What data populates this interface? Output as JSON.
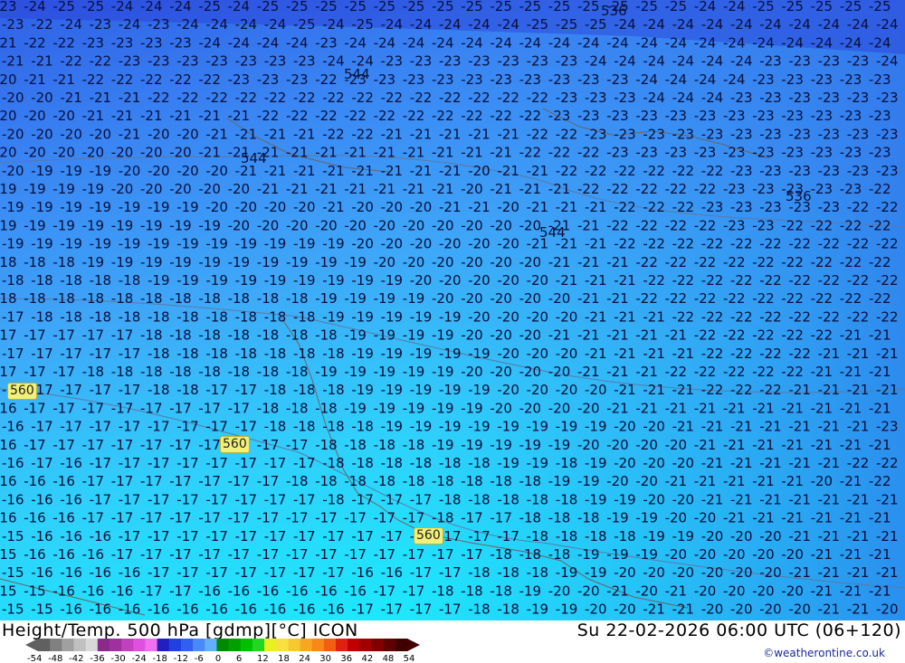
{
  "map": {
    "title": "Height/Temp. 500 hPa [gdmp][°C] ICON",
    "valid_time": "Su 22-02-2026 06:00 UTC (06+120)",
    "credit": "©weatherontine.co.uk",
    "height_labels": [
      "544",
      "544",
      "536",
      "544",
      "536",
      "560",
      "560",
      "560"
    ],
    "temperature_grid": [
      [
        "23",
        "24",
        "25",
        "25",
        "24",
        "24",
        "24",
        "25",
        "24",
        "25",
        "25",
        "25",
        "25",
        "25",
        "25",
        "25",
        "25",
        "25",
        "25",
        "25",
        "25",
        "25",
        "25",
        "25",
        "24",
        "24",
        "25",
        "25",
        "25",
        "25",
        "25",
        "24"
      ],
      [
        "23",
        "22",
        "24",
        "23",
        "24",
        "23",
        "24",
        "24",
        "24",
        "24",
        "25",
        "24",
        "25",
        "24",
        "24",
        "24",
        "24",
        "24",
        "25",
        "25",
        "25",
        "24",
        "24",
        "24",
        "24",
        "24",
        "24",
        "24",
        "24",
        "24",
        "24",
        "25"
      ],
      [
        "21",
        "22",
        "22",
        "23",
        "23",
        "23",
        "23",
        "24",
        "24",
        "24",
        "24",
        "23",
        "24",
        "24",
        "24",
        "24",
        "24",
        "24",
        "24",
        "24",
        "24",
        "24",
        "24",
        "24",
        "24",
        "24",
        "24",
        "24",
        "24",
        "24",
        "24",
        "24"
      ],
      [
        "21",
        "21",
        "22",
        "22",
        "23",
        "23",
        "23",
        "23",
        "23",
        "23",
        "23",
        "24",
        "24",
        "23",
        "23",
        "23",
        "23",
        "23",
        "23",
        "23",
        "24",
        "24",
        "24",
        "24",
        "24",
        "24",
        "23",
        "23",
        "23",
        "23",
        "24",
        "24"
      ],
      [
        "20",
        "21",
        "21",
        "22",
        "22",
        "22",
        "22",
        "22",
        "23",
        "23",
        "23",
        "22",
        "23",
        "23",
        "23",
        "23",
        "23",
        "23",
        "23",
        "23",
        "23",
        "23",
        "24",
        "24",
        "24",
        "24",
        "23",
        "23",
        "23",
        "23",
        "23",
        "23"
      ],
      [
        "20",
        "20",
        "21",
        "21",
        "21",
        "22",
        "22",
        "22",
        "22",
        "22",
        "22",
        "22",
        "22",
        "22",
        "22",
        "22",
        "22",
        "22",
        "22",
        "23",
        "23",
        "23",
        "24",
        "24",
        "24",
        "23",
        "23",
        "23",
        "23",
        "23",
        "23",
        "24"
      ],
      [
        "20",
        "20",
        "20",
        "21",
        "21",
        "21",
        "21",
        "21",
        "21",
        "22",
        "22",
        "22",
        "22",
        "22",
        "22",
        "22",
        "22",
        "22",
        "22",
        "23",
        "23",
        "23",
        "23",
        "23",
        "23",
        "23",
        "23",
        "23",
        "23",
        "23",
        "23",
        "23"
      ],
      [
        "20",
        "20",
        "20",
        "20",
        "21",
        "20",
        "20",
        "21",
        "21",
        "21",
        "21",
        "22",
        "22",
        "21",
        "21",
        "21",
        "21",
        "21",
        "22",
        "22",
        "23",
        "23",
        "23",
        "23",
        "23",
        "23",
        "23",
        "23",
        "23",
        "23",
        "23",
        "23"
      ],
      [
        "20",
        "20",
        "20",
        "20",
        "20",
        "20",
        "20",
        "21",
        "21",
        "21",
        "21",
        "21",
        "21",
        "21",
        "21",
        "21",
        "21",
        "21",
        "22",
        "22",
        "22",
        "23",
        "23",
        "23",
        "23",
        "23",
        "23",
        "23",
        "23",
        "23",
        "23",
        "23"
      ],
      [
        "20",
        "19",
        "19",
        "19",
        "20",
        "20",
        "20",
        "20",
        "21",
        "21",
        "21",
        "21",
        "21",
        "21",
        "21",
        "21",
        "20",
        "21",
        "21",
        "22",
        "22",
        "22",
        "22",
        "22",
        "22",
        "23",
        "23",
        "23",
        "23",
        "23",
        "23",
        "23"
      ],
      [
        "19",
        "19",
        "19",
        "19",
        "20",
        "20",
        "20",
        "20",
        "20",
        "21",
        "21",
        "21",
        "21",
        "21",
        "21",
        "21",
        "20",
        "21",
        "21",
        "21",
        "22",
        "22",
        "22",
        "22",
        "22",
        "23",
        "23",
        "23",
        "23",
        "23",
        "22",
        "22"
      ],
      [
        "19",
        "19",
        "19",
        "19",
        "19",
        "19",
        "19",
        "20",
        "20",
        "20",
        "20",
        "21",
        "20",
        "20",
        "20",
        "21",
        "21",
        "20",
        "21",
        "21",
        "21",
        "22",
        "22",
        "22",
        "23",
        "23",
        "23",
        "23",
        "23",
        "22",
        "22",
        "22"
      ],
      [
        "19",
        "19",
        "19",
        "19",
        "19",
        "19",
        "19",
        "19",
        "20",
        "20",
        "20",
        "20",
        "20",
        "20",
        "20",
        "20",
        "20",
        "20",
        "20",
        "21",
        "21",
        "22",
        "22",
        "22",
        "22",
        "23",
        "23",
        "22",
        "22",
        "22",
        "22",
        "22"
      ],
      [
        "19",
        "19",
        "19",
        "19",
        "19",
        "19",
        "19",
        "19",
        "19",
        "19",
        "19",
        "19",
        "20",
        "20",
        "20",
        "20",
        "20",
        "20",
        "21",
        "21",
        "21",
        "22",
        "22",
        "22",
        "22",
        "22",
        "22",
        "22",
        "22",
        "22",
        "22",
        "22"
      ],
      [
        "18",
        "18",
        "18",
        "19",
        "19",
        "19",
        "19",
        "19",
        "19",
        "19",
        "19",
        "19",
        "19",
        "20",
        "20",
        "20",
        "20",
        "20",
        "20",
        "21",
        "21",
        "21",
        "22",
        "22",
        "22",
        "22",
        "22",
        "22",
        "22",
        "22",
        "22",
        "22"
      ],
      [
        "18",
        "18",
        "18",
        "18",
        "18",
        "19",
        "19",
        "19",
        "19",
        "19",
        "19",
        "19",
        "19",
        "19",
        "20",
        "20",
        "20",
        "20",
        "20",
        "21",
        "21",
        "21",
        "22",
        "22",
        "22",
        "22",
        "22",
        "22",
        "22",
        "22",
        "22",
        "23"
      ],
      [
        "18",
        "18",
        "18",
        "18",
        "18",
        "18",
        "18",
        "18",
        "18",
        "18",
        "18",
        "19",
        "19",
        "19",
        "19",
        "20",
        "20",
        "20",
        "20",
        "20",
        "21",
        "21",
        "22",
        "22",
        "22",
        "22",
        "22",
        "22",
        "22",
        "22",
        "22",
        "22"
      ],
      [
        "17",
        "18",
        "18",
        "18",
        "18",
        "18",
        "18",
        "18",
        "18",
        "18",
        "18",
        "19",
        "19",
        "19",
        "19",
        "19",
        "20",
        "20",
        "20",
        "20",
        "21",
        "21",
        "21",
        "22",
        "22",
        "22",
        "22",
        "22",
        "22",
        "22",
        "22",
        "22"
      ],
      [
        "17",
        "17",
        "17",
        "17",
        "17",
        "18",
        "18",
        "18",
        "18",
        "18",
        "18",
        "18",
        "19",
        "19",
        "19",
        "19",
        "20",
        "20",
        "20",
        "21",
        "21",
        "21",
        "21",
        "21",
        "22",
        "22",
        "22",
        "22",
        "22",
        "21",
        "21",
        "22"
      ],
      [
        "17",
        "17",
        "17",
        "17",
        "17",
        "18",
        "18",
        "18",
        "18",
        "18",
        "18",
        "18",
        "19",
        "19",
        "19",
        "19",
        "19",
        "20",
        "20",
        "20",
        "21",
        "21",
        "21",
        "21",
        "22",
        "22",
        "22",
        "22",
        "21",
        "21",
        "21",
        "22"
      ],
      [
        "17",
        "17",
        "17",
        "18",
        "18",
        "18",
        "18",
        "18",
        "18",
        "18",
        "18",
        "19",
        "19",
        "19",
        "19",
        "19",
        "20",
        "20",
        "20",
        "20",
        "21",
        "21",
        "21",
        "22",
        "22",
        "22",
        "22",
        "22",
        "21",
        "21",
        "21",
        "22"
      ],
      [
        "16",
        "17",
        "17",
        "17",
        "17",
        "18",
        "18",
        "17",
        "17",
        "18",
        "18",
        "18",
        "19",
        "19",
        "19",
        "19",
        "19",
        "20",
        "20",
        "20",
        "20",
        "21",
        "21",
        "21",
        "22",
        "22",
        "22",
        "21",
        "21",
        "21",
        "21",
        "23"
      ],
      [
        "16",
        "17",
        "17",
        "17",
        "17",
        "17",
        "17",
        "17",
        "17",
        "18",
        "18",
        "18",
        "19",
        "19",
        "19",
        "19",
        "19",
        "20",
        "20",
        "20",
        "20",
        "21",
        "21",
        "21",
        "21",
        "21",
        "21",
        "21",
        "21",
        "21",
        "21",
        "21"
      ],
      [
        "16",
        "17",
        "17",
        "17",
        "17",
        "17",
        "17",
        "17",
        "17",
        "18",
        "18",
        "18",
        "18",
        "19",
        "19",
        "19",
        "19",
        "19",
        "19",
        "19",
        "19",
        "20",
        "20",
        "21",
        "21",
        "21",
        "21",
        "21",
        "21",
        "21",
        "23",
        "23"
      ],
      [
        "16",
        "17",
        "17",
        "17",
        "17",
        "17",
        "17",
        "17",
        "17",
        "17",
        "17",
        "18",
        "18",
        "18",
        "18",
        "19",
        "19",
        "19",
        "19",
        "19",
        "20",
        "20",
        "20",
        "20",
        "21",
        "21",
        "21",
        "21",
        "21",
        "21",
        "21",
        "22"
      ],
      [
        "16",
        "17",
        "16",
        "17",
        "17",
        "17",
        "17",
        "17",
        "17",
        "17",
        "17",
        "18",
        "18",
        "18",
        "18",
        "18",
        "18",
        "19",
        "19",
        "18",
        "19",
        "20",
        "20",
        "20",
        "21",
        "21",
        "21",
        "21",
        "21",
        "22",
        "22",
        "23"
      ],
      [
        "16",
        "16",
        "16",
        "17",
        "17",
        "17",
        "17",
        "17",
        "17",
        "17",
        "18",
        "18",
        "18",
        "18",
        "18",
        "18",
        "18",
        "18",
        "18",
        "19",
        "19",
        "20",
        "20",
        "21",
        "21",
        "21",
        "21",
        "21",
        "20",
        "21",
        "22",
        "22"
      ],
      [
        "16",
        "16",
        "16",
        "17",
        "17",
        "17",
        "17",
        "17",
        "17",
        "17",
        "17",
        "18",
        "17",
        "17",
        "17",
        "18",
        "18",
        "18",
        "18",
        "18",
        "19",
        "19",
        "20",
        "20",
        "21",
        "21",
        "21",
        "21",
        "21",
        "21",
        "21",
        "21"
      ],
      [
        "16",
        "16",
        "16",
        "17",
        "17",
        "17",
        "17",
        "17",
        "17",
        "17",
        "17",
        "17",
        "17",
        "17",
        "17",
        "18",
        "17",
        "17",
        "18",
        "18",
        "18",
        "19",
        "19",
        "20",
        "20",
        "21",
        "21",
        "21",
        "21",
        "21",
        "21",
        "22"
      ],
      [
        "15",
        "16",
        "16",
        "16",
        "17",
        "17",
        "17",
        "17",
        "17",
        "17",
        "17",
        "17",
        "17",
        "17",
        "16",
        "17",
        "17",
        "17",
        "18",
        "18",
        "18",
        "18",
        "19",
        "19",
        "20",
        "20",
        "20",
        "21",
        "21",
        "21",
        "21",
        "22"
      ],
      [
        "15",
        "16",
        "16",
        "16",
        "17",
        "17",
        "17",
        "17",
        "17",
        "17",
        "17",
        "17",
        "17",
        "17",
        "17",
        "17",
        "17",
        "18",
        "18",
        "18",
        "19",
        "19",
        "19",
        "20",
        "20",
        "20",
        "20",
        "20",
        "21",
        "21",
        "21",
        "21"
      ],
      [
        "15",
        "16",
        "16",
        "16",
        "16",
        "17",
        "17",
        "17",
        "17",
        "17",
        "17",
        "17",
        "16",
        "16",
        "17",
        "17",
        "18",
        "18",
        "18",
        "19",
        "19",
        "20",
        "20",
        "20",
        "20",
        "20",
        "20",
        "21",
        "21",
        "21",
        "21",
        "21"
      ],
      [
        "15",
        "15",
        "16",
        "16",
        "16",
        "17",
        "17",
        "16",
        "16",
        "16",
        "16",
        "16",
        "16",
        "17",
        "17",
        "18",
        "18",
        "18",
        "19",
        "20",
        "20",
        "21",
        "20",
        "21",
        "20",
        "20",
        "20",
        "20",
        "21",
        "21",
        "21",
        "21"
      ],
      [
        "15",
        "15",
        "16",
        "16",
        "16",
        "16",
        "16",
        "16",
        "16",
        "16",
        "16",
        "16",
        "17",
        "17",
        "17",
        "17",
        "18",
        "18",
        "19",
        "19",
        "20",
        "20",
        "21",
        "21",
        "20",
        "20",
        "20",
        "20",
        "21",
        "21",
        "20",
        "21"
      ]
    ],
    "colorbar": {
      "ticks": [
        "-54",
        "-48",
        "-42",
        "-36",
        "-30",
        "-24",
        "-18",
        "-12",
        "-6",
        "0",
        "6",
        "12",
        "18",
        "24",
        "30",
        "36",
        "42",
        "48",
        "54"
      ],
      "colors": [
        "#606060",
        "#808080",
        "#a0a0a0",
        "#c0c0c0",
        "#d8d8d8",
        "#8a2a8a",
        "#a030a0",
        "#c040c0",
        "#e050e0",
        "#f070f0",
        "#2020c0",
        "#2040e0",
        "#3060f0",
        "#4a8af8",
        "#60b0ff",
        "#008a00",
        "#00a000",
        "#00c000",
        "#20d820",
        "#e8f020",
        "#f8e040",
        "#f8c830",
        "#f8a820",
        "#f88818",
        "#f06010",
        "#e02010",
        "#c00000",
        "#a00000",
        "#800000",
        "#600000",
        "#400000"
      ]
    }
  }
}
